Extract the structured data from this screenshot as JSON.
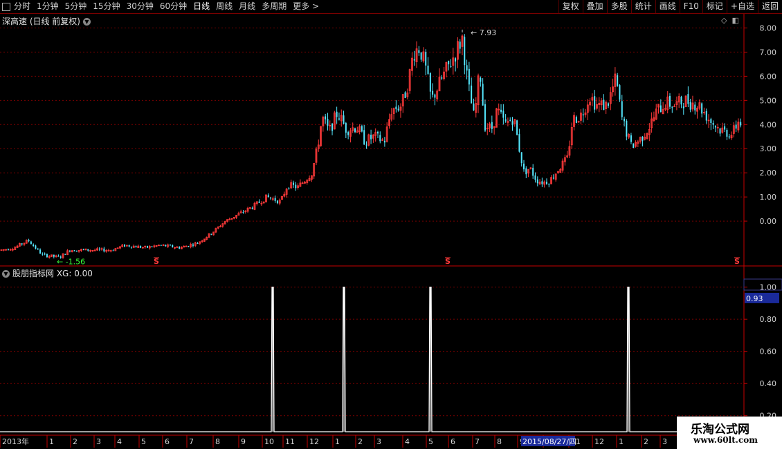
{
  "toolbar": {
    "periods": [
      "分时",
      "1分钟",
      "5分钟",
      "15分钟",
      "30分钟",
      "60分钟",
      "日线",
      "周线",
      "月线",
      "多周期",
      "更多 >"
    ],
    "active_period": "日线",
    "actions": [
      "复权",
      "叠加",
      "多股",
      "统计",
      "画线",
      "F10",
      "标记",
      "+自选",
      "返回"
    ]
  },
  "stock_title": "深高速 (日线 前复权)",
  "indicator_title": "股朋指标网 XG: 0.00",
  "watermark": {
    "line1": "乐淘公式网",
    "line2": "www.60lt.com"
  },
  "colors": {
    "up": "#ff3a3a",
    "down": "#55e8ff",
    "grid": "#7a0000",
    "axis": "#c80000",
    "signal": "#ffffff"
  },
  "chart_data": [
    {
      "type": "candlestick",
      "name": "price",
      "ylim": [
        -1.8,
        8.3
      ],
      "yticks": [
        "8.00",
        "7.00",
        "6.00",
        "5.00",
        "4.00",
        "3.00",
        "2.00",
        "1.00",
        "0.00"
      ],
      "max_label": "7.93",
      "min_label": "-1.56",
      "signal_markers": [
        "S",
        "S",
        "S"
      ],
      "x_axis_labels": [
        "2013年",
        "1",
        "2",
        "3",
        "4",
        "5",
        "6",
        "7",
        "8",
        "9",
        "10",
        "11",
        "12",
        "1",
        "2",
        "3",
        "4",
        "5",
        "6",
        "7",
        "8",
        "9",
        "10",
        "11",
        "12",
        "1",
        "2",
        "3"
      ],
      "cursor_date": "2015/08/27/四",
      "trend": [
        [
          0,
          -1.2
        ],
        [
          20,
          -1.1
        ],
        [
          40,
          -0.8
        ],
        [
          60,
          -1.4
        ],
        [
          85,
          -1.5
        ],
        [
          100,
          -1.2
        ],
        [
          130,
          -1.2
        ],
        [
          160,
          -1.2
        ],
        [
          180,
          -1.0
        ],
        [
          210,
          -1.1
        ],
        [
          230,
          -1.0
        ],
        [
          260,
          -1.1
        ],
        [
          285,
          -0.9
        ],
        [
          305,
          -0.5
        ],
        [
          325,
          0.0
        ],
        [
          345,
          0.3
        ],
        [
          365,
          0.6
        ],
        [
          385,
          1.0
        ],
        [
          405,
          0.8
        ],
        [
          415,
          1.5
        ],
        [
          430,
          1.4
        ],
        [
          450,
          2.0
        ],
        [
          458,
          3.0
        ],
        [
          465,
          4.3
        ],
        [
          475,
          3.7
        ],
        [
          487,
          4.5
        ],
        [
          500,
          3.8
        ],
        [
          515,
          3.9
        ],
        [
          527,
          3.3
        ],
        [
          540,
          3.5
        ],
        [
          555,
          3.3
        ],
        [
          565,
          4.6
        ],
        [
          580,
          4.8
        ],
        [
          590,
          5.8
        ],
        [
          597,
          7.0
        ],
        [
          606,
          7.2
        ],
        [
          614,
          6.4
        ],
        [
          623,
          5.0
        ],
        [
          640,
          6.0
        ],
        [
          655,
          6.8
        ],
        [
          668,
          7.6
        ],
        [
          675,
          5.8
        ],
        [
          685,
          4.2
        ],
        [
          693,
          6.3
        ],
        [
          700,
          4.0
        ],
        [
          710,
          3.8
        ],
        [
          718,
          4.6
        ],
        [
          730,
          4.0
        ],
        [
          742,
          4.3
        ],
        [
          750,
          3.0
        ],
        [
          757,
          2.0
        ],
        [
          765,
          2.2
        ],
        [
          775,
          1.7
        ],
        [
          785,
          1.6
        ],
        [
          795,
          1.7
        ],
        [
          808,
          2.2
        ],
        [
          820,
          2.6
        ],
        [
          827,
          4.2
        ],
        [
          840,
          4.4
        ],
        [
          852,
          5.2
        ],
        [
          862,
          4.8
        ],
        [
          877,
          4.8
        ],
        [
          890,
          5.9
        ],
        [
          898,
          4.3
        ],
        [
          912,
          3.1
        ],
        [
          925,
          3.4
        ],
        [
          938,
          3.9
        ],
        [
          950,
          4.6
        ],
        [
          962,
          4.9
        ],
        [
          975,
          4.8
        ],
        [
          990,
          5.0
        ],
        [
          1010,
          4.8
        ],
        [
          1025,
          4.2
        ],
        [
          1040,
          3.8
        ],
        [
          1058,
          3.6
        ],
        [
          1068,
          4.2
        ],
        [
          1076,
          3.8
        ]
      ],
      "signals_x": [
        226,
        647,
        1065
      ],
      "x_range": [
        0,
        1076
      ]
    },
    {
      "type": "line",
      "name": "XG",
      "ylim": [
        0.1,
        1.05
      ],
      "yticks": [
        "1.00",
        "0.80",
        "0.60",
        "0.40",
        "0.20"
      ],
      "current_value": "0.93",
      "spikes_x": [
        394,
        497,
        622,
        908
      ],
      "baseline": 0,
      "peak": 1.0
    }
  ]
}
